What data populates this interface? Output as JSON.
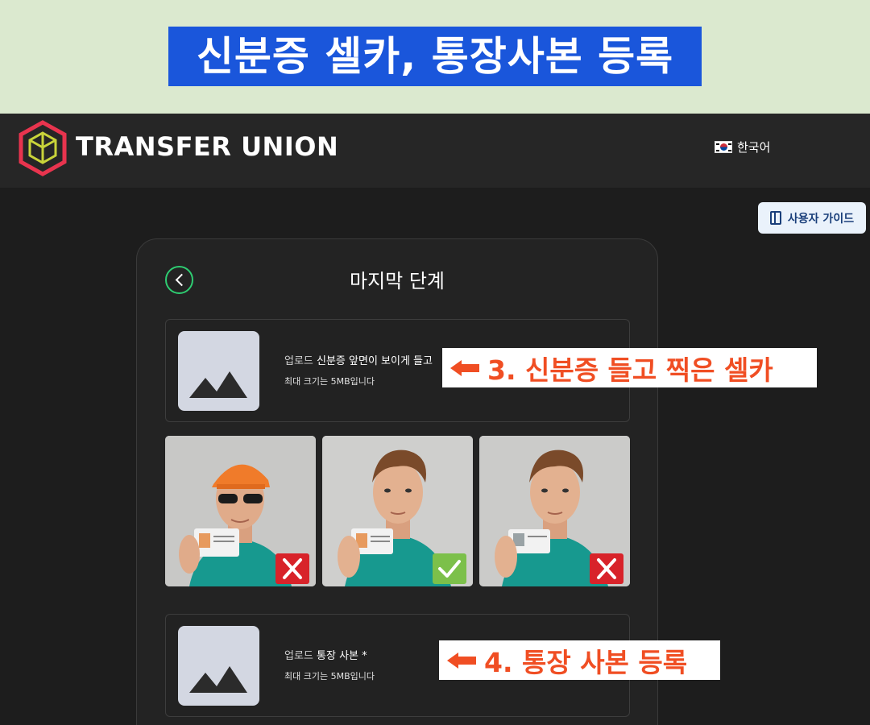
{
  "banner": {
    "title": "신분증 셀카, 통장사본 등록"
  },
  "header": {
    "brand": "TRANSFER UNION",
    "language": "한국어"
  },
  "guide_button": {
    "label": "사용자 가이드"
  },
  "card": {
    "title": "마지막 단계",
    "selfie_upload": {
      "prefix": "업로드 ",
      "label": "신분증 앞면이 보이게 들고",
      "hint": "최대 크기는 5MB입니다"
    },
    "examples": [
      {
        "status": "incorrect",
        "icon": "x-icon"
      },
      {
        "status": "correct",
        "icon": "check-icon"
      },
      {
        "status": "incorrect",
        "icon": "x-icon"
      }
    ],
    "bank_upload": {
      "prefix": "업로드 ",
      "label": "통장 사본 *",
      "hint": "최대 크기는 5MB입니다"
    }
  },
  "annotations": {
    "step3": "3. 신분증 들고 찍은 셀카",
    "step4": "4. 통장 사본 등록"
  },
  "colors": {
    "banner_bg": "#dbe9cf",
    "banner_title_bg": "#1a56db",
    "page_bg": "#1d1d1d",
    "accent_green": "#2ecc71",
    "callout_text": "#f04e23",
    "bad_mark": "#d8232a",
    "good_mark": "#7cc04a"
  }
}
